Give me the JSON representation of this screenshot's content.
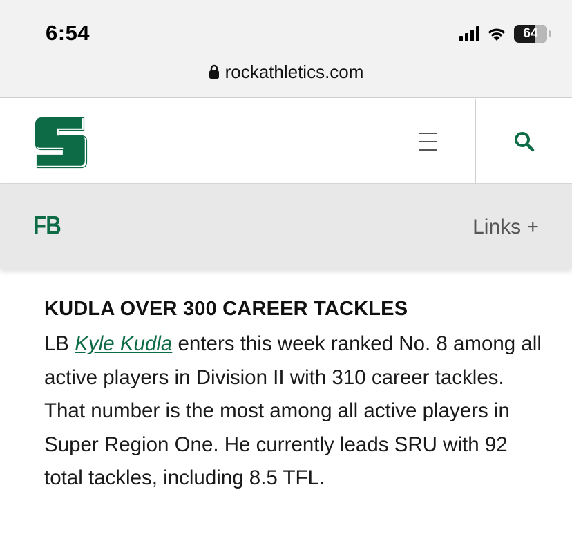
{
  "status_bar": {
    "time": "6:54",
    "battery_level": "64",
    "icons": [
      "cellular-signal-icon",
      "wifi-icon",
      "battery-icon"
    ]
  },
  "browser": {
    "url": "rockathletics.com",
    "lock_icon": "lock-icon"
  },
  "site_header": {
    "logo_letter": "S",
    "menu_icon": "hamburger-menu-icon",
    "search_icon": "search-icon"
  },
  "sub_nav": {
    "sport": "FB",
    "links_label": "Links +"
  },
  "article": {
    "headline": "KUDLA OVER 300 CAREER TACKLES",
    "body_prefix": "LB ",
    "player_name": "Kyle Kudla",
    "body_text": " enters this week ranked No. 8 among all active players in Division II with 310 career tackles. That number is the most among all active players in Super Region One. He currently leads SRU with 92 total tackles, including 8.5 TFL."
  },
  "colors": {
    "brand_green": "#0d6b45",
    "browser_chrome": "#f2f2f2",
    "subnav_bg": "#e8e8e8"
  }
}
